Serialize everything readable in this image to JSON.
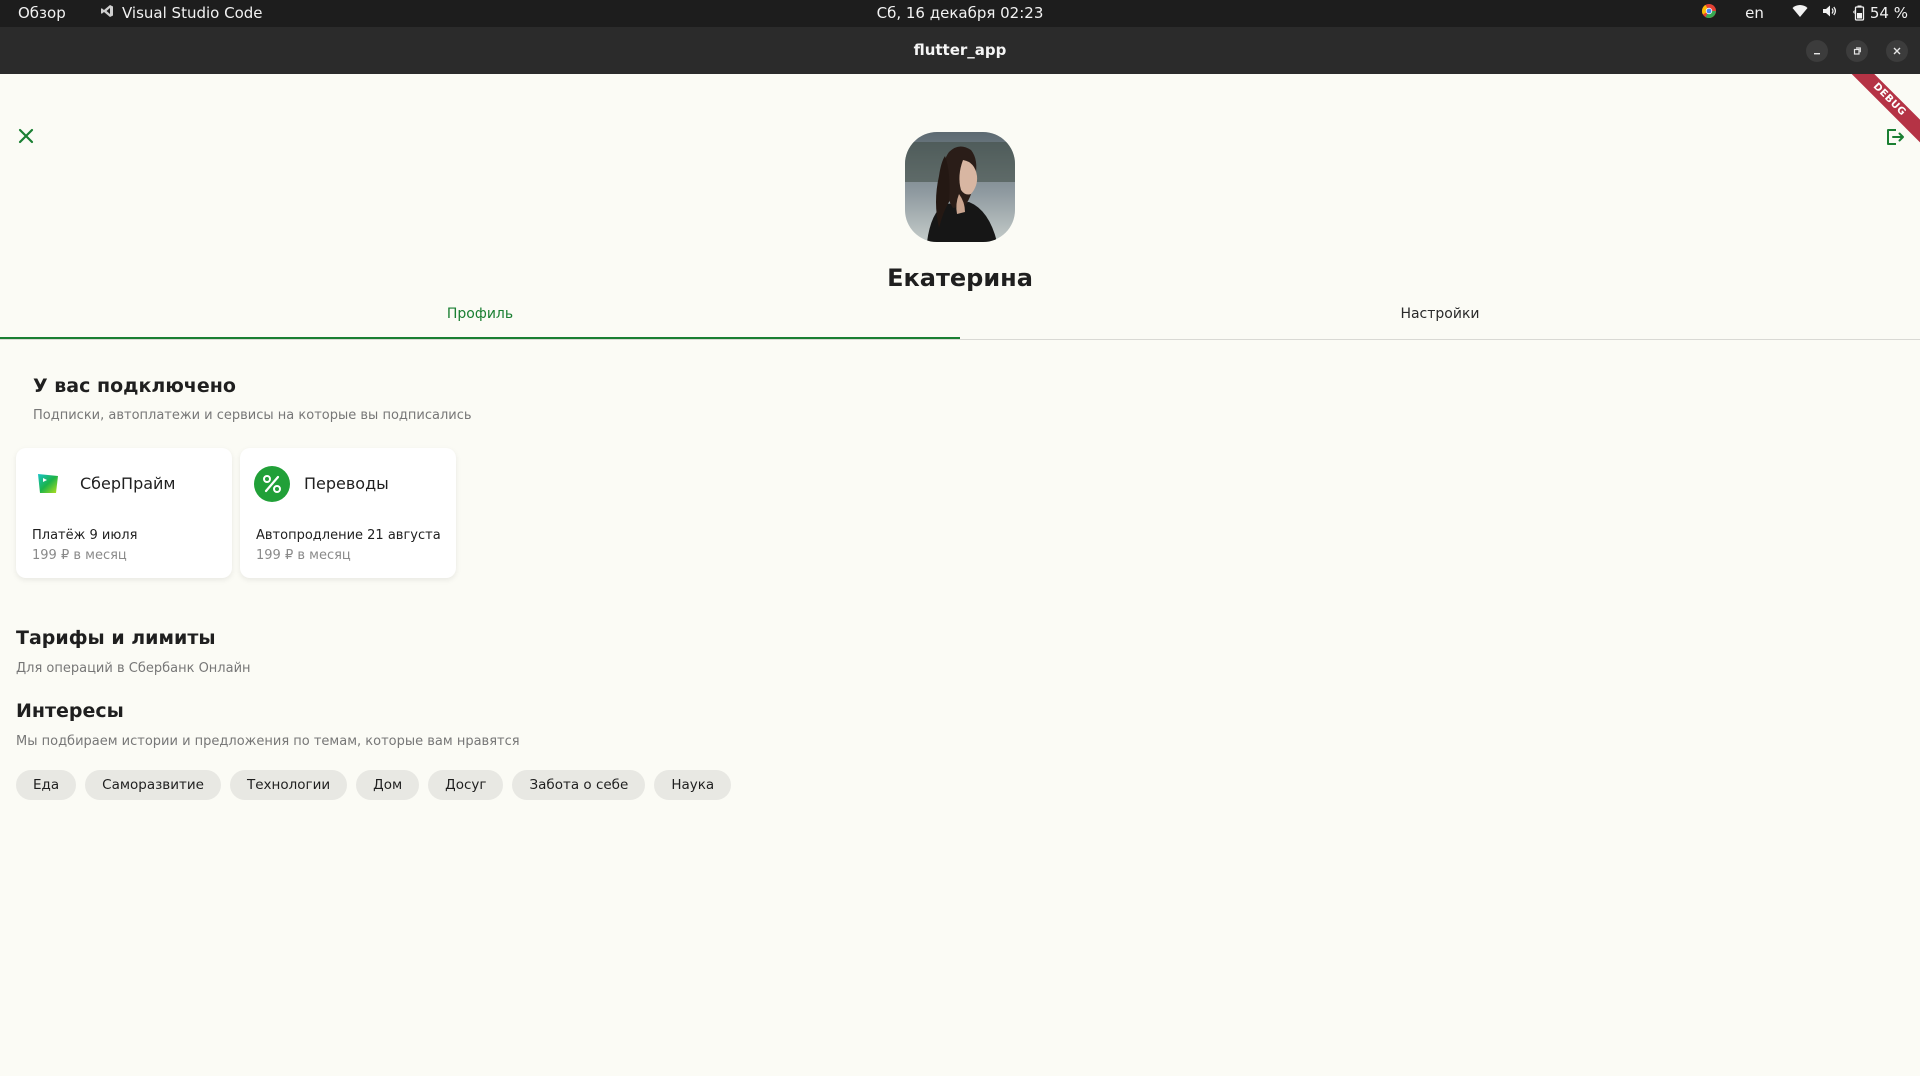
{
  "topbar": {
    "activities": "Обзор",
    "app_name": "Visual Studio Code",
    "clock": "Сб, 16 декабря  02:23",
    "lang": "en",
    "battery": "54 %"
  },
  "window": {
    "title": "flutter_app"
  },
  "debug_banner": "DEBUG",
  "profile": {
    "name": "Екатерина"
  },
  "tabs": [
    {
      "label": "Профиль",
      "active": true
    },
    {
      "label": "Настройки",
      "active": false
    }
  ],
  "subscriptions": {
    "title": "У вас подключено",
    "subtitle": "Подписки, автоплатежи и сервисы на которые вы подписались",
    "cards": [
      {
        "name": "СберПрайм",
        "line1": "Платёж 9 июля",
        "line2": "199 ₽ в месяц",
        "icon": "sberprime-logo"
      },
      {
        "name": "Переводы",
        "line1": "Автопродление 21 августа",
        "line2": "199 ₽ в месяц",
        "icon": "percent-icon"
      }
    ]
  },
  "tariffs": {
    "title": "Тарифы и лимиты",
    "subtitle": "Для операций в Сбербанк Онлайн"
  },
  "interests": {
    "title": "Интересы",
    "subtitle": "Мы подбираем истории и предложения по темам, которые вам нравятся",
    "chips": [
      "Еда",
      "Саморазвитие",
      "Технологии",
      "Дом",
      "Досуг",
      "Забота о себе",
      "Наука"
    ]
  },
  "colors": {
    "accent": "#1a7f32",
    "background": "#fbfbf5",
    "chip": "#e8e8e3"
  }
}
